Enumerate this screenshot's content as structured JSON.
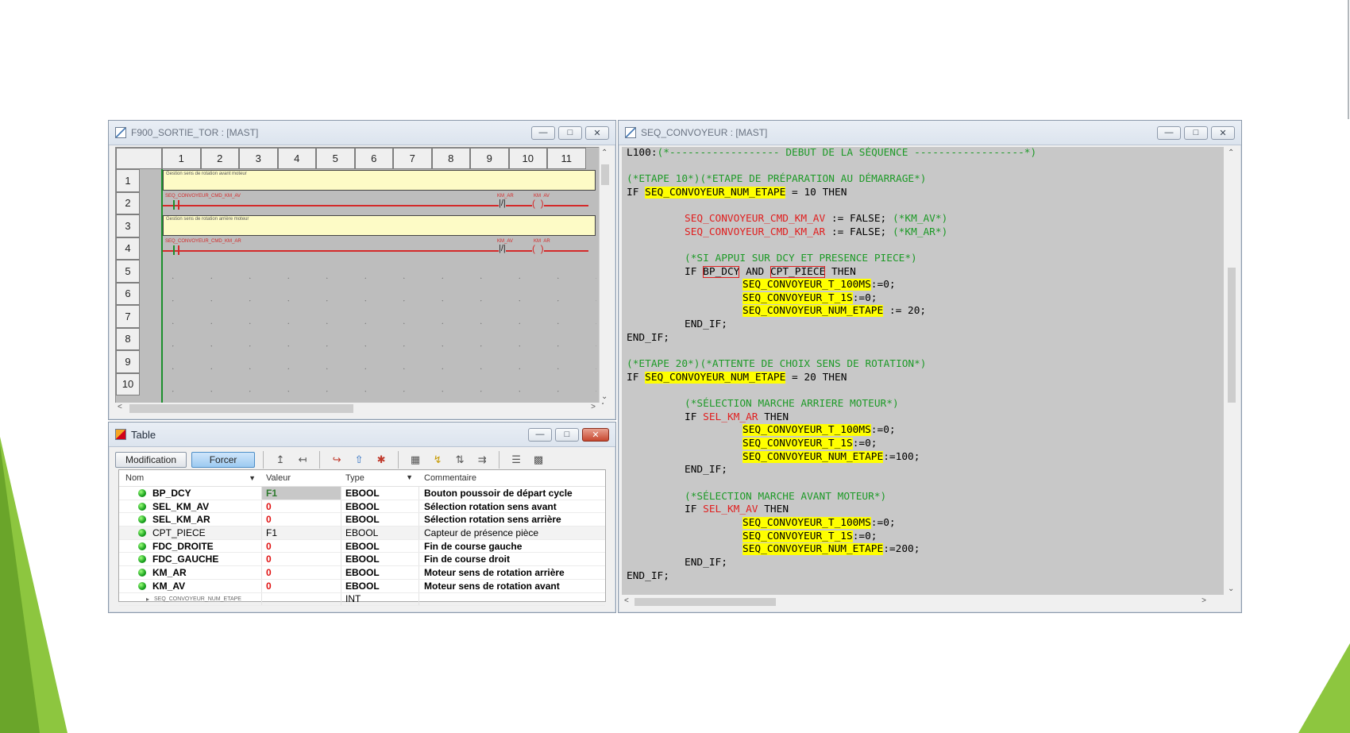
{
  "ladder_window": {
    "title": "F900_SORTIE_TOR : [MAST]",
    "columns": [
      "1",
      "2",
      "3",
      "4",
      "5",
      "6",
      "7",
      "8",
      "9",
      "10",
      "11"
    ],
    "rows": [
      "1",
      "2",
      "3",
      "4",
      "5",
      "6",
      "7",
      "8",
      "9",
      "10"
    ],
    "comment1": "Gestion sens de rotation avant moteur",
    "comment2": "Gestion sens de rotation arrière moteur",
    "rung1": {
      "left": "SEQ_CONVOYEUR_CMD_KM_AV",
      "contact": "KM_AR",
      "coil": "KM_AV"
    },
    "rung2": {
      "left": "SEQ_CONVOYEUR_CMD_KM_AR",
      "contact": "KM_AV",
      "coil": "KM_AR"
    }
  },
  "table_window": {
    "title": "Table",
    "buttons": {
      "modification": "Modification",
      "forcer": "Forcer"
    },
    "headers": {
      "name": "Nom",
      "value": "Valeur",
      "type": "Type",
      "comment": "Commentaire"
    },
    "rows": [
      {
        "name": "BP_DCY",
        "value": "F1",
        "type": "EBOOL",
        "comment": "Bouton poussoir de départ cycle"
      },
      {
        "name": "SEL_KM_AV",
        "value": "0",
        "type": "EBOOL",
        "comment": "Sélection rotation sens avant"
      },
      {
        "name": "SEL_KM_AR",
        "value": "0",
        "type": "EBOOL",
        "comment": "Sélection rotation sens arrière"
      },
      {
        "name": "CPT_PIECE",
        "value": "F1",
        "type": "EBOOL",
        "comment": "Capteur de présence pièce"
      },
      {
        "name": "FDC_DROITE",
        "value": "0",
        "type": "EBOOL",
        "comment": "Fin de course gauche"
      },
      {
        "name": "FDC_GAUCHE",
        "value": "0",
        "type": "EBOOL",
        "comment": "Fin de course droit"
      },
      {
        "name": "KM_AR",
        "value": "0",
        "type": "EBOOL",
        "comment": "Moteur sens de rotation arrière"
      },
      {
        "name": "KM_AV",
        "value": "0",
        "type": "EBOOL",
        "comment": "Moteur sens de rotation avant"
      }
    ],
    "last_row": {
      "name": "SEQ_CONVOYEUR_NUM_ETAPE",
      "type": "INT"
    }
  },
  "code_window": {
    "title": "SEQ_CONVOYEUR : [MAST]",
    "l0_label": "L100:",
    "l0_comment": "(*------------------ DEBUT DE LA SÉQUENCE ------------------*)",
    "c_step10": "(*ETAPE 10*)(*ETAPE DE PRÉPARATION AU DÉMARRAGE*)",
    "kw_if": "IF",
    "kw_then": "THEN",
    "kw_and": "AND",
    "kw_endif": "END_IF;",
    "var_num_etape": "SEQ_CONVOYEUR_NUM_ETAPE",
    "eq10": " = 10 ",
    "eq20": " = 20 ",
    "cmd_av": "SEQ_CONVOYEUR_CMD_KM_AV",
    "cmd_ar": "SEQ_CONVOYEUR_CMD_KM_AR",
    "assign_false": " := FALSE; ",
    "c_km_av": "(*KM_AV*)",
    "c_km_ar": "(*KM_AR*)",
    "c_appui": "(*SI APPUI SUR DCY ET PRESENCE PIECE*)",
    "bp_dcy": "BP_DCY",
    "cpt_piece": "CPT_PIECE",
    "t100": "SEQ_CONVOYEUR_T_100MS",
    "t1s": "SEQ_CONVOYEUR_T_1S",
    "assign0": ":=0;",
    "assign20": " := 20;",
    "assign100": ":=100;",
    "assign200": ":=200;",
    "c_step20": "(*ETAPE 20*)(*ATTENTE DE CHOIX SENS DE ROTATION*)",
    "c_sel_ar": "(*SÉLECTION MARCHE ARRIERE MOTEUR*)",
    "sel_km_ar": "SEL_KM_AR",
    "c_sel_av": "(*SÉLECTION MARCHE AVANT MOTEUR*)",
    "sel_km_av": "SEL_KM_AV"
  },
  "colors": {
    "accent_green": "#8dc63f",
    "keyword_red": "#e02020",
    "comment_green": "#1e9a28",
    "highlight": "#ffff00"
  }
}
